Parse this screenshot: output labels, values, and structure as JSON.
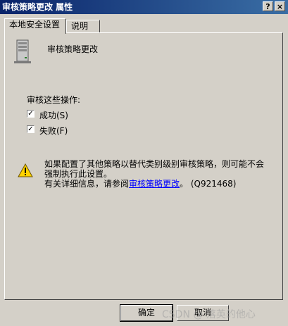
{
  "window": {
    "title": "审核策略更改 属性",
    "help_button": "?",
    "close_button": "×"
  },
  "tabs": [
    {
      "label": "本地安全设置",
      "active": true
    },
    {
      "label": "说明",
      "active": false
    }
  ],
  "policy": {
    "name": "审核策略更改",
    "icon": "server-icon"
  },
  "audit": {
    "label": "审核这些操作:",
    "options": [
      {
        "label": "成功(S)",
        "checked": true
      },
      {
        "label": "失败(F)",
        "checked": true
      }
    ]
  },
  "warning": {
    "icon": "warning-icon",
    "line1": "如果配置了其他策略以替代类别级别审核策略，则可能不会强制执行此设置。",
    "line2_prefix": "有关详细信息，请参阅",
    "link_text": "审核策略更改",
    "line2_suffix": "。 (Q921468)"
  },
  "buttons": {
    "ok": "确定",
    "cancel": "取消"
  },
  "watermark": "CSDN @ 落英的他心"
}
